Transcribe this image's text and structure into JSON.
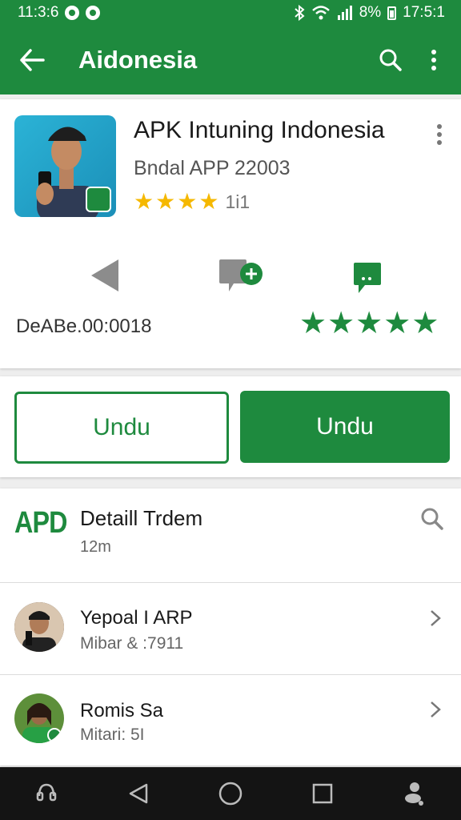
{
  "status_bar": {
    "time_left": "11:3:6",
    "battery": "8%",
    "time_right": "17:5:1"
  },
  "appbar": {
    "title": "Aidonesia",
    "back_icon": "arrow-left-icon",
    "search_icon": "search-icon",
    "more_icon": "more-vert-icon"
  },
  "app": {
    "title": "APK Intuning Indonesia",
    "subtitle": "Bndal APP 22003",
    "rating_stars": 4,
    "rating_count": "1i1",
    "stats_date": "DeABe.00:0018",
    "stats_stars": 5,
    "icons": [
      "play-back-icon",
      "add-comment-icon",
      "chat-icon"
    ]
  },
  "buttons": {
    "outline_label": "Undu",
    "fill_label": "Undu"
  },
  "detail": {
    "logo": "APD",
    "title": "Detaill Trdem",
    "subtitle": "12m"
  },
  "list": [
    {
      "name": "Yepoal I ARP",
      "sub": "Mibar & :7911"
    },
    {
      "name": "Romis Sa",
      "sub": "Mitari: 5I"
    }
  ],
  "navbar": [
    "assistant-icon",
    "back-triangle-icon",
    "home-circle-icon",
    "recents-square-icon",
    "accessibility-icon"
  ],
  "colors": {
    "primary": "#1e8a3e",
    "star_yellow": "#f5b800",
    "navbar": "#141414"
  }
}
